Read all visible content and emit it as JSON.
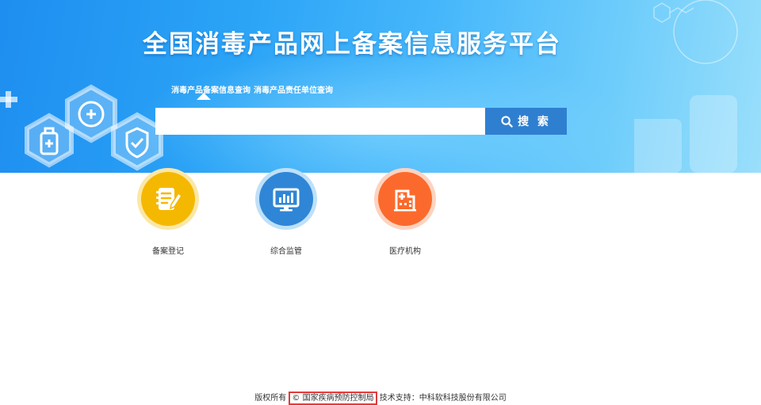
{
  "header": {
    "title": "全国消毒产品网上备案信息服务平台"
  },
  "search": {
    "tabs": [
      {
        "label": "消毒产品备案信息查询",
        "active": true
      },
      {
        "label": "消毒产品责任单位查询",
        "active": false
      }
    ],
    "input_value": "",
    "button_label": "搜 索",
    "button_icon": "search-icon"
  },
  "tiles": [
    {
      "label": "备案登记",
      "icon": "notebook-edit-icon",
      "color": "#f5b800"
    },
    {
      "label": "综合监管",
      "icon": "monitor-chart-icon",
      "color": "#2f86d6"
    },
    {
      "label": "医疗机构",
      "icon": "hospital-icon",
      "color": "#fb6a2c"
    }
  ],
  "footer": {
    "copyright_prefix": "版权所有",
    "owner": "© 国家疾病预防控制局",
    "tech_support": "技术支持：中科软科技股份有限公司"
  },
  "colors": {
    "banner_start": "#1e8ef0",
    "banner_end": "#9adffb",
    "search_button": "#2f7fd0",
    "footer_highlight_border": "#e23b3b"
  }
}
